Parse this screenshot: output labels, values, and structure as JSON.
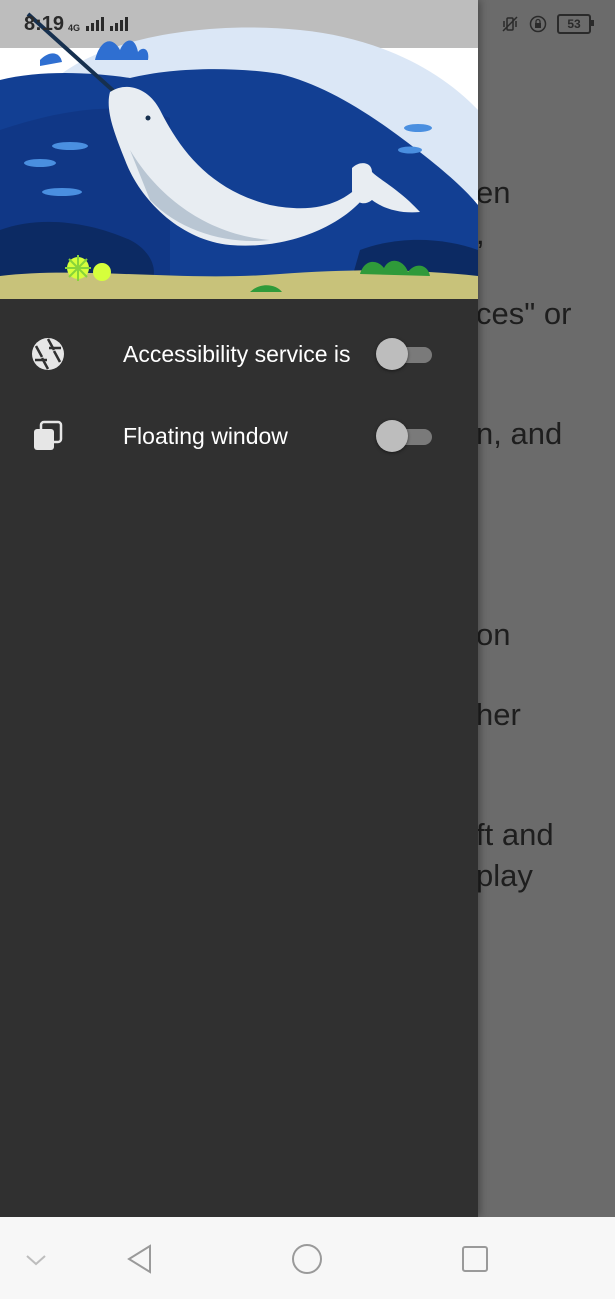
{
  "status_bar": {
    "time": "8:19",
    "network": "4G",
    "battery": "53"
  },
  "drawer": {
    "items": [
      {
        "label": "Accessibility service is",
        "icon": "shutter-icon",
        "enabled": false
      },
      {
        "label": "Floating window",
        "icon": "floating-window-icon",
        "enabled": false
      }
    ]
  },
  "background_page": {
    "lines": [
      "en",
      ",",
      "ces\" or",
      "n, and",
      "on",
      "her",
      "ft and",
      "play"
    ]
  },
  "navigation_bar": {
    "buttons": [
      "collapse-icon",
      "back-icon",
      "home-icon",
      "recents-icon"
    ]
  },
  "colors": {
    "drawer_bg": "#303030",
    "scrim": "#6b6b6b",
    "ocean": "#123f93",
    "sand": "#c8c27a"
  }
}
